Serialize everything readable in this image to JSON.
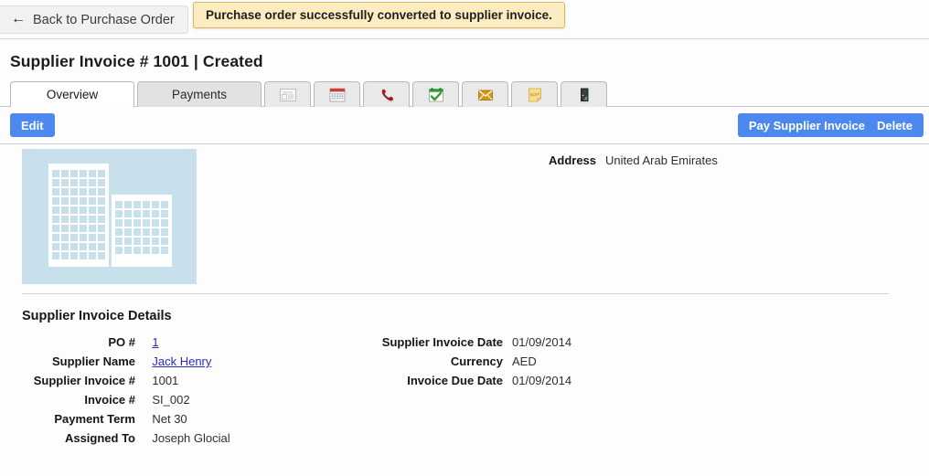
{
  "topbar": {
    "back_label": "Back to Purchase Order",
    "back_icon": "arrow-left-icon",
    "toast_message": "Purchase order successfully converted to supplier invoice."
  },
  "header": {
    "title": "Supplier Invoice # 1001",
    "separator": "|",
    "status": "Created"
  },
  "tabs": [
    {
      "label": "Overview",
      "type": "text",
      "active": true
    },
    {
      "label": "Payments",
      "type": "text",
      "active": false
    },
    {
      "label": "News",
      "type": "icon",
      "icon": "news-icon",
      "active": false
    },
    {
      "label": "Calendar",
      "type": "icon",
      "icon": "calendar-icon",
      "active": false
    },
    {
      "label": "Calls",
      "type": "icon",
      "icon": "phone-icon",
      "active": false
    },
    {
      "label": "Tasks",
      "type": "icon",
      "icon": "task-check-icon",
      "active": false
    },
    {
      "label": "Emails",
      "type": "icon",
      "icon": "envelope-icon",
      "active": false
    },
    {
      "label": "Notes",
      "type": "icon",
      "icon": "note-icon",
      "active": false
    },
    {
      "label": "Documents",
      "type": "icon",
      "icon": "door-exit-icon",
      "active": false
    }
  ],
  "actions": {
    "edit_label": "Edit",
    "pay_label": "Pay Supplier Invoice",
    "delete_label": "Delete",
    "accent_color": "#4d88ef"
  },
  "address": {
    "label": "Address",
    "value": "United Arab Emirates"
  },
  "photo": {
    "name": "building-placeholder-image",
    "background_color": "#c7e0ec",
    "building_color": "#ffffff"
  },
  "details": {
    "section_title": "Supplier Invoice Details",
    "left": [
      {
        "label": "PO #",
        "value": "1",
        "link": true
      },
      {
        "label": "Supplier Name",
        "value": "Jack Henry",
        "link": true
      },
      {
        "label": "Supplier Invoice #",
        "value": "1001",
        "link": false
      },
      {
        "label": "Invoice #",
        "value": "SI_002",
        "link": false
      },
      {
        "label": "Payment Term",
        "value": "Net 30",
        "link": false
      },
      {
        "label": "Assigned To",
        "value": "Joseph Glocial",
        "link": false
      }
    ],
    "right": [
      {
        "label": "Supplier Invoice Date",
        "value": "01/09/2014",
        "link": false
      },
      {
        "label": "Currency",
        "value": "AED",
        "link": false
      },
      {
        "label": "Invoice Due Date",
        "value": "01/09/2014",
        "link": false
      }
    ]
  }
}
